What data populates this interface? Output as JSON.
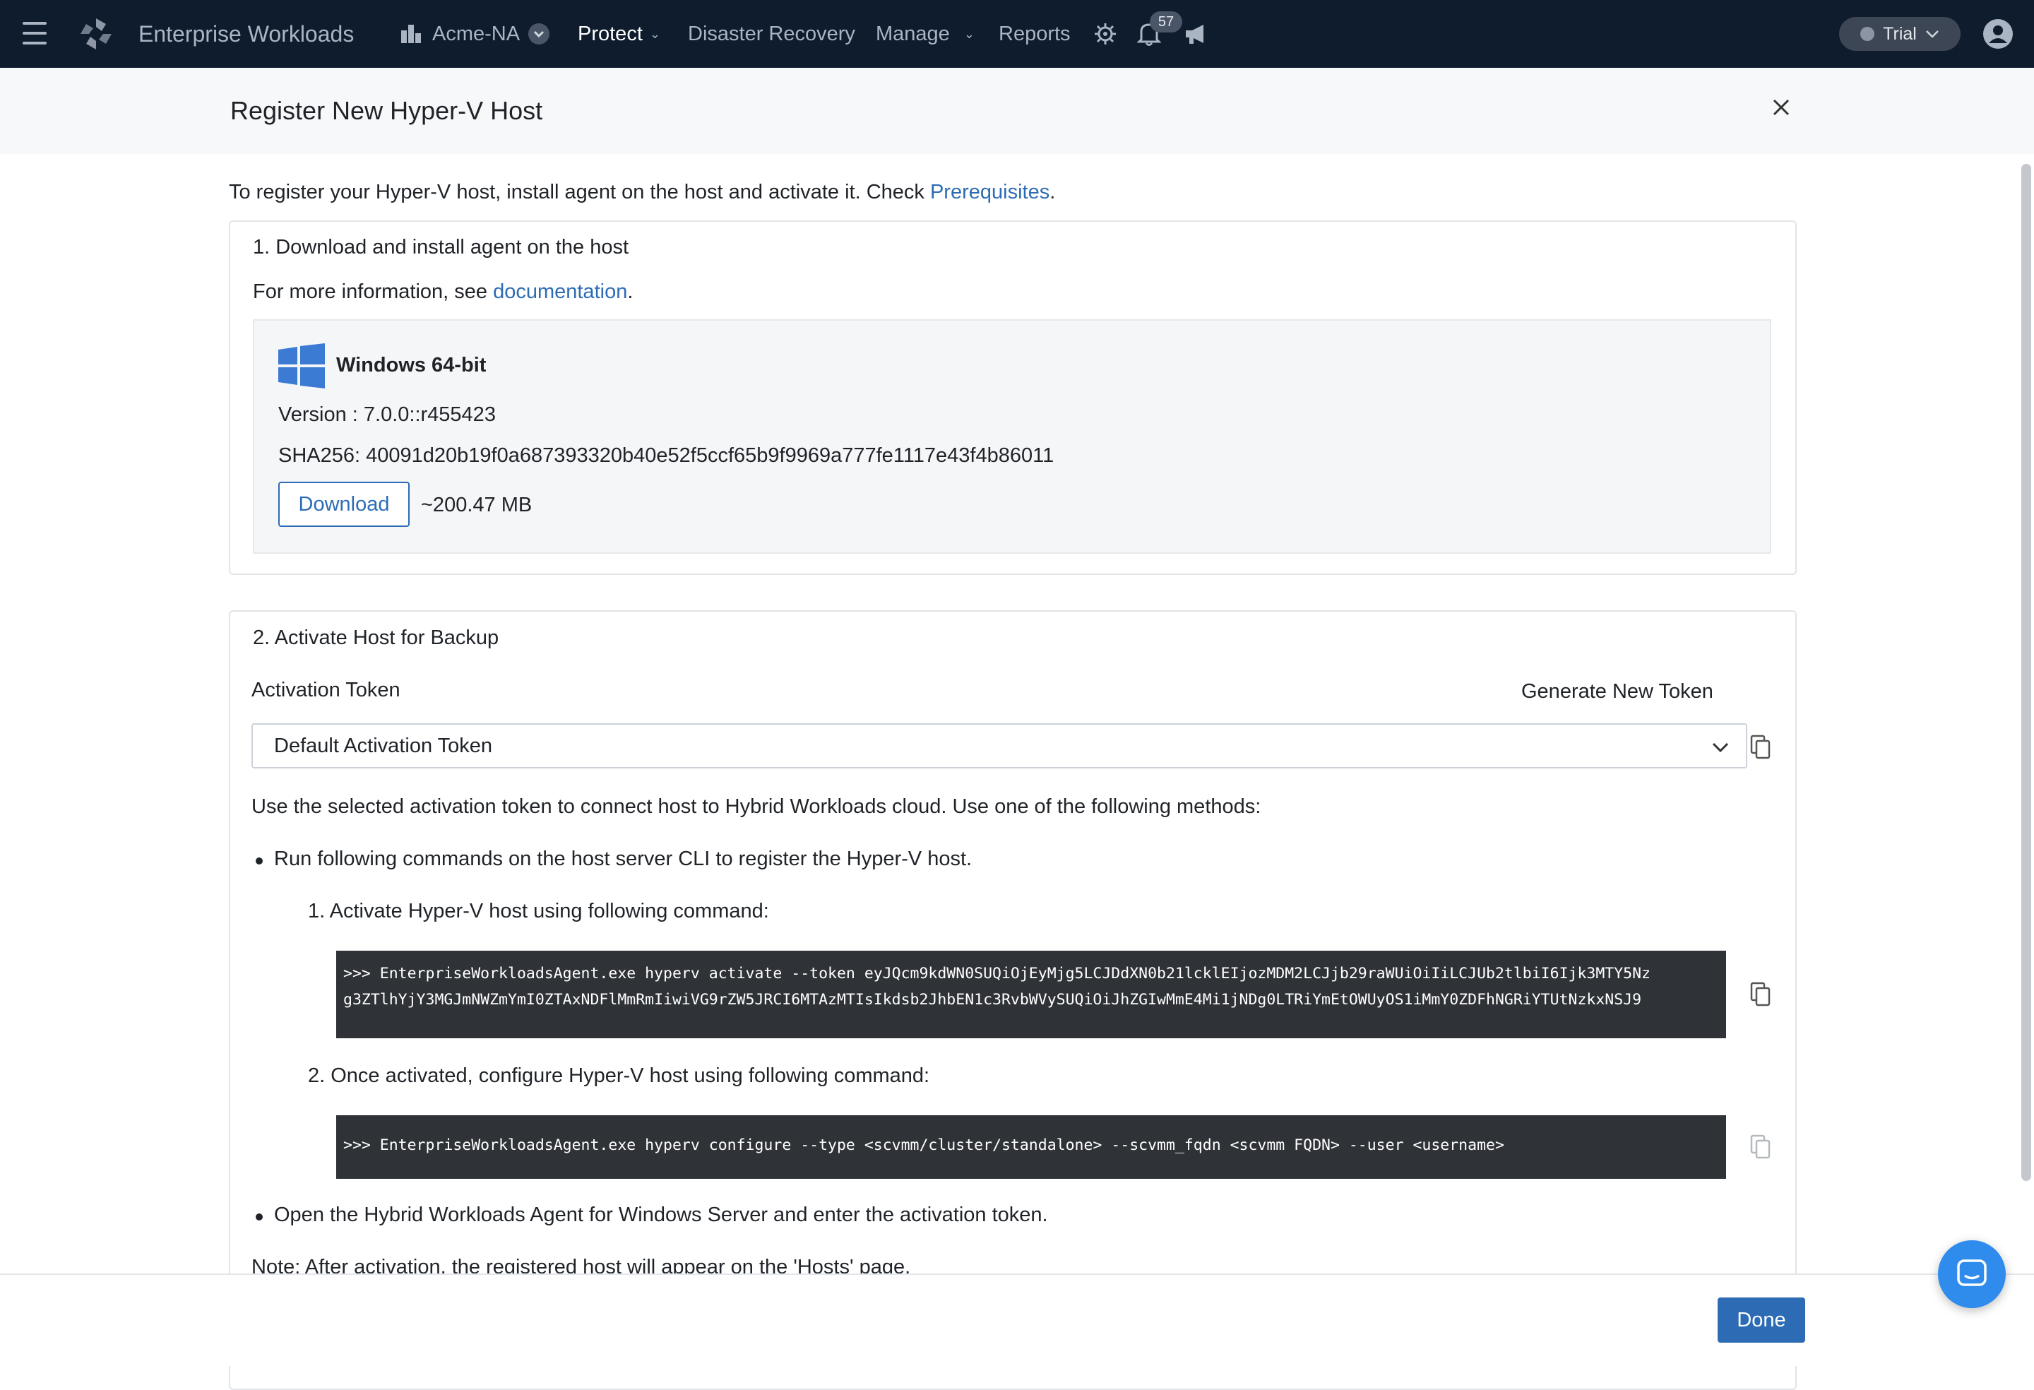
{
  "nav": {
    "app_name": "Enterprise Workloads",
    "org": "Acme-NA",
    "items": [
      "Protect",
      "Disaster Recovery",
      "Manage",
      "Reports"
    ],
    "notification_count": "57",
    "trial_label": "Trial"
  },
  "modal": {
    "title": "Register New Hyper-V Host",
    "intro": "To register your Hyper-V host, install agent on the host and activate it. Check ",
    "intro_link": "Prerequisites",
    "intro_end": ".",
    "step1": {
      "title": "1. Download and install agent on the host",
      "info": "For more information, see ",
      "info_link": "documentation",
      "info_end": ".",
      "platform": "Windows 64-bit",
      "version": "Version : 7.0.0::r455423",
      "sha": "SHA256: 40091d20b19f0a687393320b40e52f5ccf65b9f9969a777fe1117e43f4b86011",
      "download_label": "Download",
      "size": "~200.47 MB"
    },
    "step2": {
      "title": "2. Activate Host for Backup",
      "token_label": "Activation Token",
      "generate_label": "Generate New Token",
      "token_selected": "Default Activation Token",
      "use_text": "Use the selected activation token to connect host to Hybrid Workloads cloud. Use one of the following methods:",
      "bullet1": "Run following commands on the host server CLI to register the Hyper-V host.",
      "sub1": "1. Activate Hyper-V host using following command:",
      "cmd1": ">>> EnterpriseWorkloadsAgent.exe hyperv activate --token eyJQcm9kdWN0SUQiOjEyMjg5LCJDdXN0b21lcklEIjozMDM2LCJjb29raWUiOiIiLCJUb2tlbiI6Ijk3MTY5Nz\ng3ZTlhYjY3MGJmNWZmYmI0ZTAxNDFlMmRmIiwiVG9rZW5JRCI6MTAzMTIsIkdsb2JhbEN1c3RvbWVySUQiOiJhZGIwMmE4Mi1jNDg0LTRiYmEtOWUyOS1iMmY0ZDFhNGRiYTUtNzkxNSJ9",
      "sub2": "2. Once activated, configure Hyper-V host using following command:",
      "cmd2": ">>> EnterpriseWorkloadsAgent.exe hyperv configure --type <scvmm/cluster/standalone> --scvmm_fqdn <scvmm FQDN> --user <username>",
      "bullet2": "Open the Hybrid Workloads Agent for Windows Server and enter the activation token.",
      "note": "Note: After activation, the registered host will appear on the 'Hosts' page."
    },
    "done_label": "Done"
  }
}
